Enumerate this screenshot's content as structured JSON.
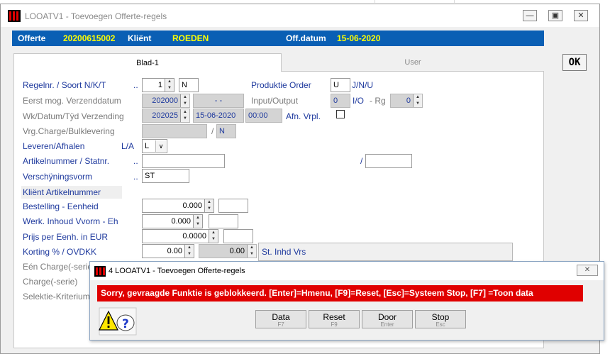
{
  "window": {
    "title": "LOOATV1 - Toevoegen Offerte-regels"
  },
  "header": {
    "offerte_label": "Offerte",
    "offerte_value": "20200615002",
    "klient_label": "Kliënt",
    "klient_value": "ROEDEN",
    "offdatum_label": "Off.datum",
    "offdatum_value": "15-06-2020"
  },
  "tabs": [
    {
      "label": "Blad-1",
      "active": true
    },
    {
      "label": "User",
      "active": false
    }
  ],
  "ok_label": "OK",
  "form": {
    "regelnr_label": "Regelnr. / Soort  N/K/T",
    "regelnr_dots": "..",
    "regelnr_value": "1",
    "soort_value": "N",
    "produktie_label": "Produktie Order",
    "produktie_value": "U",
    "produktie_options": "J/N/U",
    "eerst_label": "Eerst mog. Verzenddatum",
    "eerst_week": "202000",
    "eerst_date": "- -",
    "inout_label": "Input/Output",
    "inout_value": "0",
    "io_label": "I/O",
    "rg_label": "- Rg",
    "rg_value": "0",
    "wk_label": "Wk/Datum/Tÿd Verzending",
    "wk_week": "202025",
    "wk_date": "15-06-2020",
    "wk_time": "00:00",
    "afn_label": "Afn. Vrpl.",
    "vrg_label": "Vrg.Charge/Bulklevering",
    "vrg_slash": "/",
    "vrg_value": "N",
    "leveren_label": "Leveren/Afhalen",
    "la_label": "L/A",
    "leveren_value": "L",
    "artikel_label": "Artikelnummer / Statnr.",
    "artikel_dots": "..",
    "artikel_slash": "/",
    "verschijning_label": "Verschÿningsvorm",
    "verschijning_dots": "..",
    "verschijning_value": "ST",
    "klient_artikel_label": "Kliënt Artikelnummer",
    "bestelling_label": "Bestelling - Eenheid",
    "bestelling_value": "0.000",
    "werk_label": "Werk. Inhoud Vvorm - Eh",
    "werk_value": "0.000",
    "prijs_label": "Prijs per Eenh. in EUR",
    "prijs_value": "0.0000",
    "korting_label": "Korting % / OVDKK",
    "korting_pct": "0.00",
    "korting_ovdkk": "0.00",
    "st_inhd_label": "St. Inhd Vrs",
    "een_charge_label": "Eén Charge(-serie",
    "charge_label": "Charge(-serie)",
    "selektie_label": "Selektie-Kriterium"
  },
  "dialog": {
    "title": "4 LOOATV1 - Toevoegen Offerte-regels",
    "message": "Sorry, gevraagde Funktie is geblokkeerd.  [Enter]=Hmenu, [F9]=Reset, [Esc]=Systeem Stop, [F7] =Toon data",
    "buttons": [
      {
        "label": "Data",
        "key": "F7"
      },
      {
        "label": "Reset",
        "key": "F9"
      },
      {
        "label": "Door",
        "key": "Enter"
      },
      {
        "label": "Stop",
        "key": "Esc"
      }
    ]
  }
}
